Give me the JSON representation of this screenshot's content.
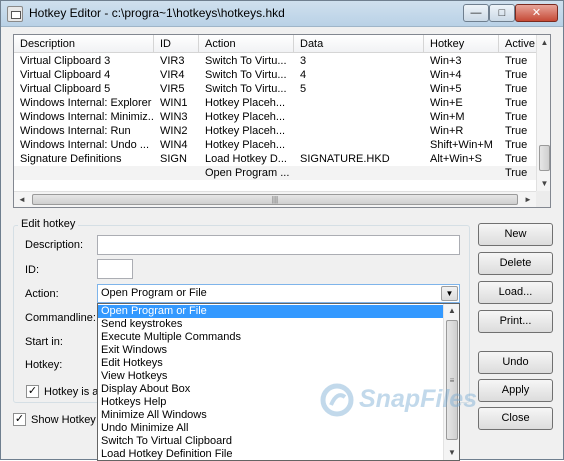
{
  "window": {
    "title": "Hotkey Editor - c:\\progra~1\\hotkeys\\hotkeys.hkd",
    "caption_buttons": {
      "minimize": "—",
      "maximize": "□",
      "close": "✕"
    }
  },
  "list": {
    "columns": [
      "Description",
      "ID",
      "Action",
      "Data",
      "Hotkey",
      "Active"
    ],
    "rows": [
      [
        "Virtual Clipboard 3",
        "VIR3",
        "Switch To Virtu...",
        "3",
        "Win+3",
        "True"
      ],
      [
        "Virtual Clipboard 4",
        "VIR4",
        "Switch To Virtu...",
        "4",
        "Win+4",
        "True"
      ],
      [
        "Virtual Clipboard 5",
        "VIR5",
        "Switch To Virtu...",
        "5",
        "Win+5",
        "True"
      ],
      [
        "Windows Internal: Explorer",
        "WIN1",
        "Hotkey Placeh...",
        "",
        "Win+E",
        "True"
      ],
      [
        "Windows Internal: Minimiz...",
        "WIN3",
        "Hotkey Placeh...",
        "",
        "Win+M",
        "True"
      ],
      [
        "Windows Internal: Run",
        "WIN2",
        "Hotkey Placeh...",
        "",
        "Win+R",
        "True"
      ],
      [
        "Windows Internal: Undo ...",
        "WIN4",
        "Hotkey Placeh...",
        "",
        "Shift+Win+M",
        "True"
      ],
      [
        "Signature Definitions",
        "SIGN",
        "Load Hotkey D...",
        "SIGNATURE.HKD",
        "Alt+Win+S",
        "True"
      ],
      [
        "",
        "",
        "Open Program ...",
        "",
        "",
        "True"
      ]
    ],
    "scroll_icons": {
      "up": "▲",
      "down": "▼",
      "left": "◄",
      "right": "►",
      "grip": "|||",
      "vgrip": "≡"
    }
  },
  "edit": {
    "group_title": "Edit hotkey",
    "description_label": "Description:",
    "description_value": "",
    "id_label": "ID:",
    "id_value": "",
    "action_label": "Action:",
    "action_value": "Open Program or File",
    "action_arrow": "▼",
    "commandline_label": "Commandline:",
    "startin_label": "Start in:",
    "hotkey_label": "Hotkey:",
    "hotkey_active_label": "Hotkey is a",
    "hotkey_active_checked": "✓"
  },
  "show_hotkeys": {
    "label": "Show Hotkey",
    "checked": "✓"
  },
  "action_options": [
    "Open Program or File",
    "Send keystrokes",
    "Execute Multiple Commands",
    "Exit Windows",
    "Edit Hotkeys",
    "View Hotkeys",
    "Display About Box",
    "Hotkeys Help",
    "Minimize All Windows",
    "Undo Minimize All",
    "Switch To Virtual Clipboard",
    "Load Hotkey Definition File"
  ],
  "selected_option_index": 0,
  "buttons": {
    "new": "New",
    "delete": "Delete",
    "load": "Load...",
    "print": "Print...",
    "undo": "Undo",
    "apply": "Apply",
    "close": "Close"
  },
  "watermark": "SnapFiles",
  "colors": {
    "selection": "#3399ff",
    "titlebar": "#b9d1e6",
    "close_button": "#c64a36"
  }
}
